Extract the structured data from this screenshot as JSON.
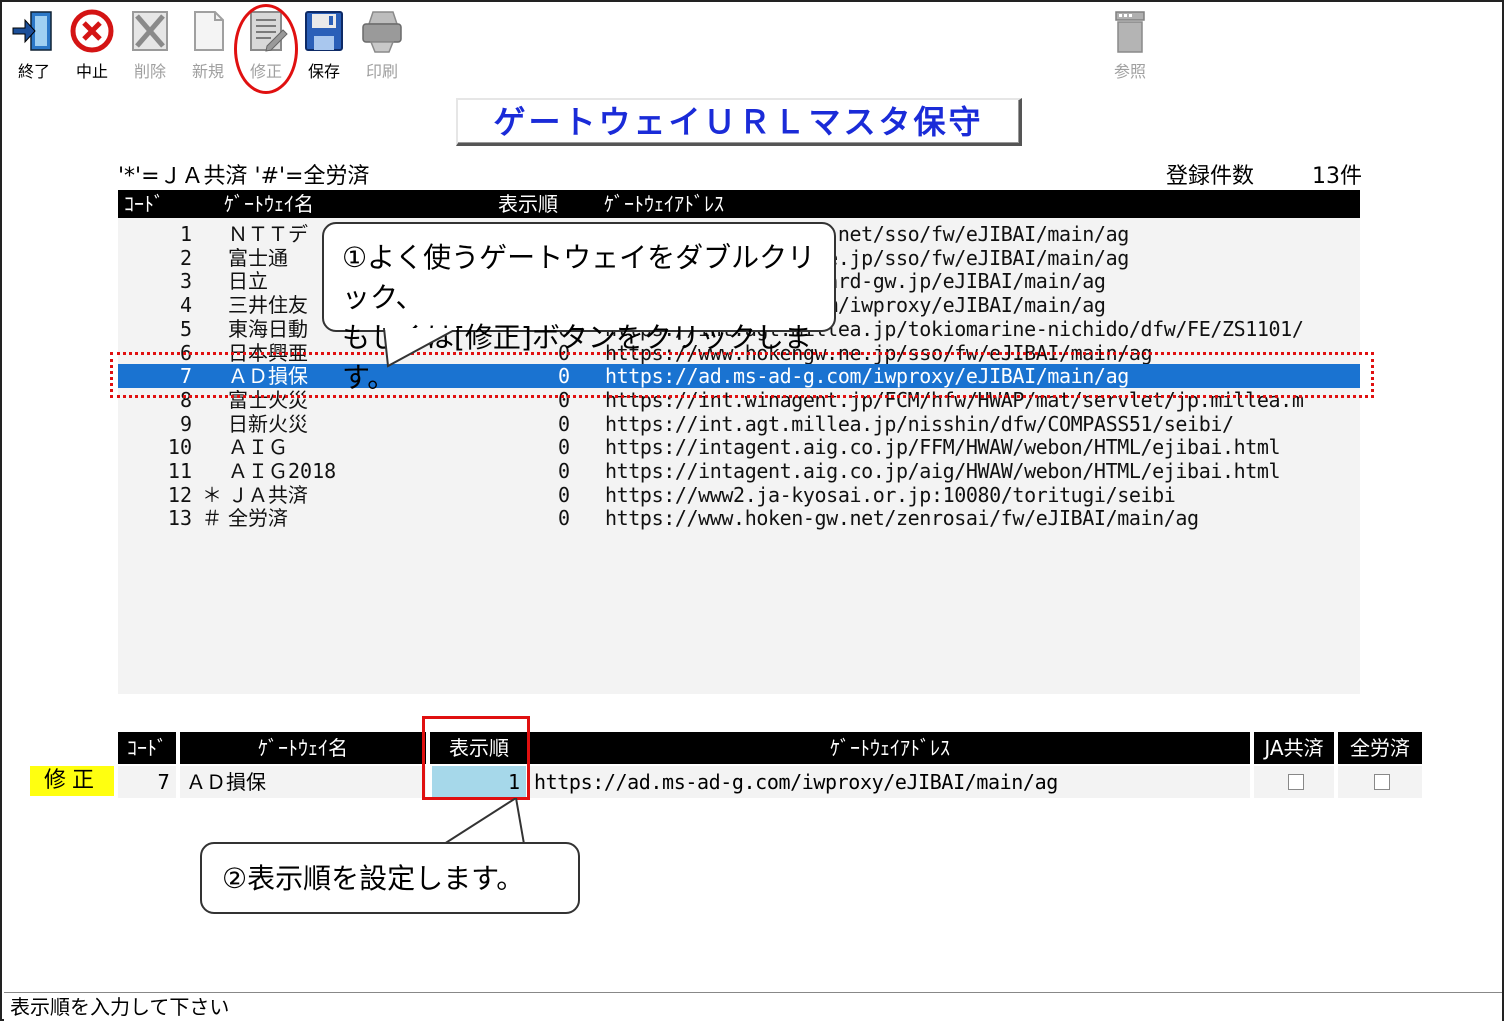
{
  "toolbar": {
    "exit": "終了",
    "stop": "中止",
    "delete": "削除",
    "new": "新規",
    "modify": "修正",
    "save": "保存",
    "print": "印刷",
    "reference": "参照"
  },
  "title": "ゲートウェイＵＲＬマスタ保守",
  "legend": "'*'=ＪＡ共済 '#'=全労済",
  "count": {
    "label": "登録件数",
    "value": "13件"
  },
  "list": {
    "headers": {
      "code": "ｺｰﾄﾞ",
      "name": "ｹﾞｰﾄｳｪｲ名",
      "order": "表示順",
      "address": "ｹﾞｰﾄｳｪｲｱﾄﾞﾚｽ"
    },
    "rows": [
      {
        "code": "1",
        "mark": "",
        "name": "ＮＴＴデ",
        "order": "",
        "address": "                  w.net/sso/fw/eJIBAI/main/ag"
      },
      {
        "code": "2",
        "mark": "",
        "name": "富士通",
        "order": "",
        "address": "                  ne.jp/sso/fw/eJIBAI/main/ag"
      },
      {
        "code": "3",
        "mark": "",
        "name": "日立",
        "order": "",
        "address": "                 rward-gw.jp/eJIBAI/main/ag"
      },
      {
        "code": "4",
        "mark": "",
        "name": "三井住友",
        "order": "",
        "address": "                 com/iwproxy/eJIBAI/main/ag"
      },
      {
        "code": "5",
        "mark": "",
        "name": "東海日動",
        "order": "0",
        "address": "https://int.agt.millea.jp/tokiomarine-nichido/dfw/FE/ZS1101/"
      },
      {
        "code": "6",
        "mark": "",
        "name": "日本興亜",
        "order": "0",
        "address": "https://www.hokengw.ne.jp/sso/fw/eJIBAI/main/ag"
      },
      {
        "code": "7",
        "mark": "",
        "name": "ＡＤ損保",
        "order": "0",
        "address": "https://ad.ms-ad-g.com/iwproxy/eJIBAI/main/ag"
      },
      {
        "code": "8",
        "mark": "",
        "name": "富士火災",
        "order": "0",
        "address": "https://int.winagent.jp/FCM/hfw/HWAP/mat/servlet/jp.millea.m"
      },
      {
        "code": "9",
        "mark": "",
        "name": "日新火災",
        "order": "0",
        "address": "https://int.agt.millea.jp/nisshin/dfw/COMPASS51/seibi/"
      },
      {
        "code": "10",
        "mark": "",
        "name": "ＡＩＧ",
        "order": "0",
        "address": "https://intagent.aig.co.jp/FFM/HWAW/webon/HTML/ejibai.html"
      },
      {
        "code": "11",
        "mark": "",
        "name": "ＡＩＧ2018",
        "order": "0",
        "address": "https://intagent.aig.co.jp/aig/HWAW/webon/HTML/ejibai.html"
      },
      {
        "code": "12",
        "mark": "＊",
        "name": "ＪＡ共済",
        "order": "0",
        "address": "https://www2.ja-kyosai.or.jp:10080/toritugi/seibi"
      },
      {
        "code": "13",
        "mark": "＃",
        "name": "全労済",
        "order": "0",
        "address": "https://www.hoken-gw.net/zenrosai/fw/eJIBAI/main/ag"
      }
    ]
  },
  "edit": {
    "headers": {
      "code": "ｺｰﾄﾞ",
      "name": "ｹﾞｰﾄｳｪｲ名",
      "order": "表示順",
      "address": "ｹﾞｰﾄｳｪｲｱﾄﾞﾚｽ",
      "ja": "JA共済",
      "zenrosai": "全労済"
    },
    "mode": "修正",
    "code": "7",
    "name": "ＡＤ損保",
    "order": "1",
    "address": "https://ad.ms-ad-g.com/iwproxy/eJIBAI/main/ag"
  },
  "callouts": {
    "step1_line1": "①よく使うゲートウェイをダブルクリック、",
    "step1_line2": "もしくは[修正]ボタンをクリックします。",
    "step2": "②表示順を設定します。"
  },
  "status": "表示順を入力して下さい",
  "colors": {
    "selection": "#1a73d1",
    "title_text": "#1a2bd8",
    "highlight": "#e01010",
    "mode_badge": "#ffff10",
    "input_bg": "#a6d8ea"
  }
}
